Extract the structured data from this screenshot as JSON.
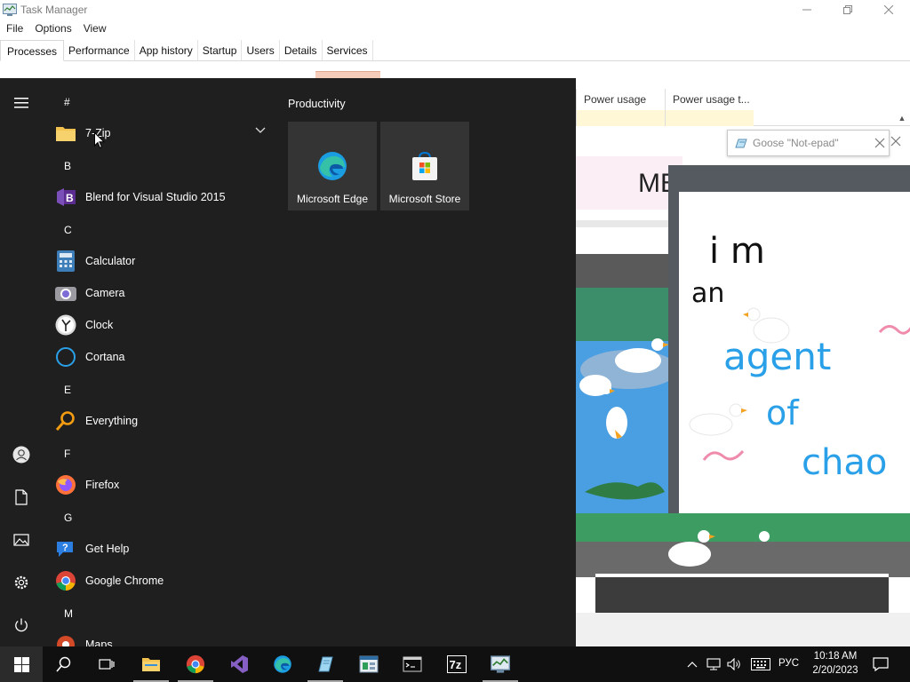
{
  "task_manager": {
    "title": "Task Manager",
    "menu": [
      "File",
      "Options",
      "View"
    ],
    "tabs": [
      "Processes",
      "Performance",
      "App history",
      "Startup",
      "Users",
      "Details",
      "Services"
    ],
    "active_tab": "Processes",
    "columns": {
      "power": "Power usage",
      "power_trend": "Power usage t..."
    }
  },
  "goose_window": {
    "tab_title": "Goose \"Not-epad\"",
    "handwriting": [
      "i m",
      "an",
      "agent",
      "of",
      "chao"
    ]
  },
  "start_menu": {
    "groups": [
      {
        "letter": "#",
        "apps": [
          {
            "label": "7-Zip",
            "icon": "folder-icon",
            "expandable": true
          }
        ]
      },
      {
        "letter": "B",
        "apps": [
          {
            "label": "Blend for Visual Studio 2015",
            "icon": "blend-icon"
          }
        ]
      },
      {
        "letter": "C",
        "apps": [
          {
            "label": "Calculator",
            "icon": "calculator-icon"
          },
          {
            "label": "Camera",
            "icon": "camera-icon"
          },
          {
            "label": "Clock",
            "icon": "clock-icon"
          },
          {
            "label": "Cortana",
            "icon": "cortana-icon"
          }
        ]
      },
      {
        "letter": "E",
        "apps": [
          {
            "label": "Everything",
            "icon": "everything-search-icon"
          }
        ]
      },
      {
        "letter": "F",
        "apps": [
          {
            "label": "Firefox",
            "icon": "firefox-icon"
          }
        ]
      },
      {
        "letter": "G",
        "apps": [
          {
            "label": "Get Help",
            "icon": "get-help-icon"
          },
          {
            "label": "Google Chrome",
            "icon": "chrome-icon"
          }
        ]
      },
      {
        "letter": "M",
        "apps": [
          {
            "label": "Maps",
            "icon": "maps-icon"
          }
        ]
      }
    ],
    "tiles_heading": "Productivity",
    "tiles": [
      {
        "label": "Microsoft Edge",
        "icon": "edge-icon"
      },
      {
        "label": "Microsoft Store",
        "icon": "store-icon"
      }
    ]
  },
  "taskbar": {
    "pinned": [
      "start-icon",
      "search-icon",
      "task-view-icon",
      "file-explorer-icon",
      "chrome-icon",
      "visual-studio-icon",
      "edge-icon",
      "notepad-icon",
      "app-icon",
      "terminal-icon",
      "7zip-icon",
      "task-manager-icon"
    ],
    "language": "РУС",
    "time": "10:18 AM",
    "date": "2/20/2023"
  },
  "colors": {
    "start_bg": "#1f1f1f",
    "taskbar_bg": "#101010",
    "tile_bg": "#343434",
    "accent_blue": "#2aa0e8"
  }
}
